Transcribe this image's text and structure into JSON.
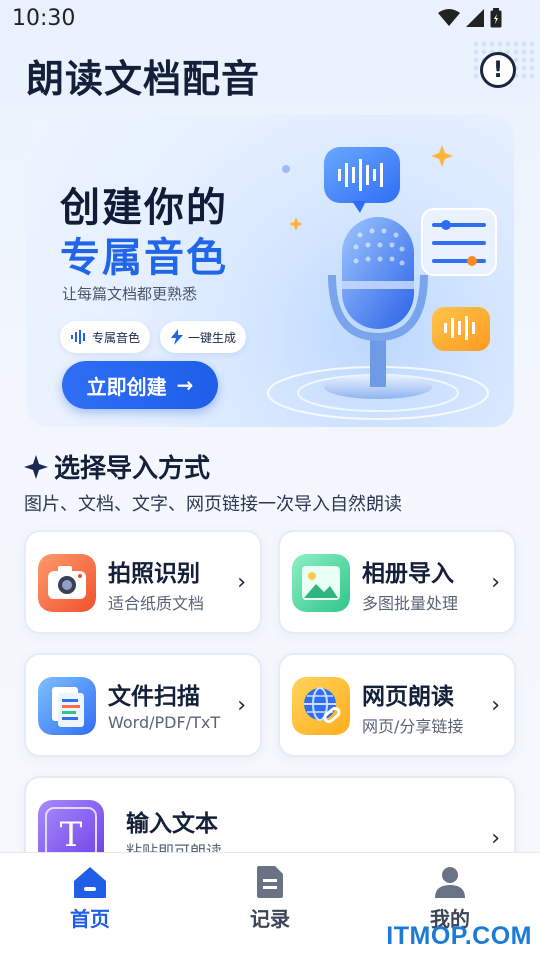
{
  "status_bar": {
    "time": "10:30"
  },
  "header": {
    "title": "朗读文档配音",
    "info_icon": "info-icon"
  },
  "banner": {
    "title_line1": "创建你的",
    "title_line2": "专属音色",
    "subtitle": "让每篇文档都更熟悉",
    "chips": [
      {
        "label": "专属音色",
        "icon": "sound-wave-icon"
      },
      {
        "label": "一键生成",
        "icon": "lightning-icon"
      }
    ],
    "cta_label": "立即创建",
    "cta_arrow": "→",
    "accent": "#2266e8"
  },
  "section": {
    "title": "选择导入方式",
    "subtitle": "图片、文档、文字、网页链接一次导入自然朗读"
  },
  "options": [
    {
      "title": "拍照识别",
      "subtitle": "适合纸质文档",
      "icon": "camera-icon",
      "arrow": "›"
    },
    {
      "title": "相册导入",
      "subtitle": "多图批量处理",
      "icon": "photo-album-icon",
      "arrow": "›"
    },
    {
      "title": "文件扫描",
      "subtitle": "Word/PDF/TxT",
      "icon": "document-files-icon",
      "arrow": "›"
    },
    {
      "title": "网页朗读",
      "subtitle": "网页/分享链接",
      "icon": "globe-link-icon",
      "arrow": "›"
    },
    {
      "title": "输入文本",
      "subtitle": "粘贴即可朗读",
      "icon": "text-t-icon",
      "arrow": "›"
    }
  ],
  "bottom_nav": [
    {
      "label": "首页",
      "icon": "home-icon",
      "active": true
    },
    {
      "label": "记录",
      "icon": "document-icon",
      "active": false
    },
    {
      "label": "我的",
      "icon": "user-icon",
      "active": false
    }
  ],
  "watermark": "ITMOP.COM"
}
